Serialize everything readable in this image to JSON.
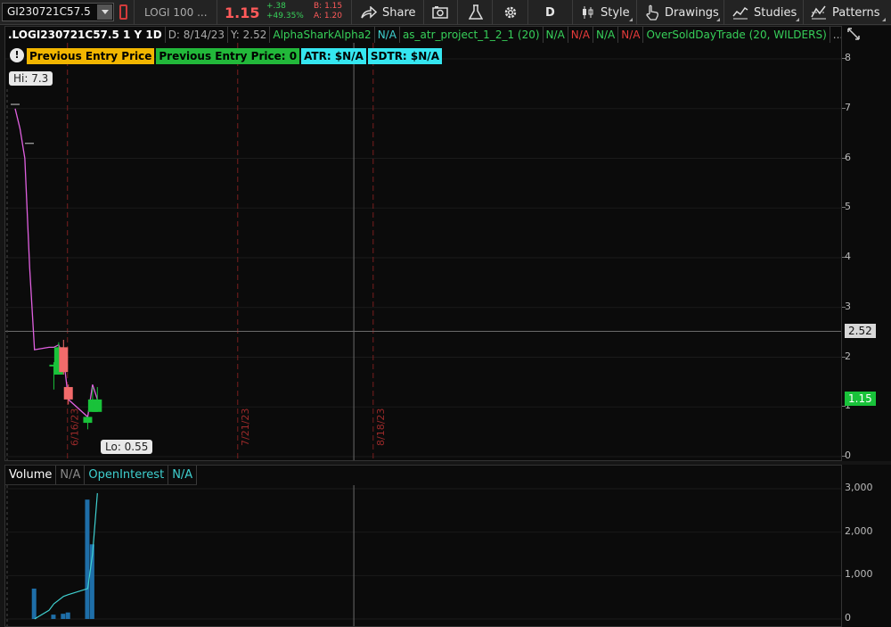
{
  "toolbar": {
    "symbol": "GI230721C57.5",
    "description": "LOGI 100 ...",
    "last": "1.15",
    "net_change": "+.38",
    "pct_change": "+49.35%",
    "bid": "B: 1.15",
    "ask": "A: 1.20",
    "share": "Share",
    "period": "D",
    "style": "Style",
    "drawings": "Drawings",
    "studies": "Studies",
    "patterns": "Patterns"
  },
  "info": {
    "title": ".LOGI230721C57.5 1 Y 1D",
    "date": "D: 8/14/23",
    "y": "Y: 2.52",
    "study1": "AlphaSharkAlpha2",
    "study1_val": "N/A",
    "study2": "as_atr_project_1_2_1 (20)",
    "study2_v1": "N/A",
    "study2_v2": "N/A",
    "study2_v3": "N/A",
    "study2_v4": "N/A",
    "study3": "OverSoldDayTrade (20, WILDERS)",
    "more": "..."
  },
  "badges": {
    "alert": "!",
    "prev_entry": "Previous Entry Price",
    "prev_entry_val": "Previous Entry Price: 0",
    "atr": "ATR: $N/A",
    "sdtr": "SDTR: $N/A"
  },
  "callouts": {
    "hi": "Hi: 7.3",
    "lo": "Lo: 0.55"
  },
  "dates": [
    "6/16/23",
    "7/21/23",
    "8/18/23"
  ],
  "price_axis": {
    "ticks": [
      "8",
      "7",
      "6",
      "5",
      "4",
      "3",
      "2",
      "1",
      "0"
    ],
    "cursor_value": "2.52",
    "last_value": "1.15"
  },
  "volume": {
    "label": "Volume",
    "value": "N/A",
    "oi_label": "OpenInterest",
    "oi_value": "N/A",
    "ticks": [
      "3,000",
      "2,000",
      "1,000",
      "0"
    ]
  },
  "colors": {
    "up": "#19c23a",
    "down": "#f26b6b",
    "line": "#e060e0",
    "oi": "#3fd0d0",
    "vol": "#1e6ea8",
    "accent_green": "#37d05a"
  },
  "chart_data": {
    "type": "candlestick",
    "x": [
      "6/13/23",
      "6/14/23",
      "6/15/23",
      "6/16/23",
      "6/20/23",
      "6/21/23",
      "6/22/23"
    ],
    "open": [
      1.85,
      1.65,
      2.2,
      1.4,
      0.68,
      0.9,
      0.9
    ],
    "high": [
      1.9,
      2.3,
      2.35,
      1.45,
      0.8,
      1.4,
      1.4
    ],
    "low": [
      1.35,
      1.65,
      1.65,
      1.05,
      0.55,
      0.9,
      0.9
    ],
    "close": [
      1.85,
      2.2,
      1.7,
      1.15,
      0.8,
      1.15,
      1.15
    ],
    "line_x": [
      "6/5/23",
      "6/6/23",
      "6/7/23",
      "6/8/23",
      "6/9/23",
      "6/12/23",
      "6/13/23",
      "6/14/23",
      "6/15/23",
      "6/16/23",
      "6/20/23",
      "6/21/23",
      "6/22/23"
    ],
    "line_y": [
      7.0,
      6.6,
      6.0,
      3.8,
      2.15,
      2.2,
      2.2,
      2.25,
      2.0,
      1.15,
      0.8,
      1.45,
      1.15
    ],
    "volume_x": [
      "6/9/23",
      "6/13/23",
      "6/15/23",
      "6/16/23",
      "6/20/23",
      "6/21/23"
    ],
    "volume": [
      700,
      100,
      120,
      150,
      2750,
      1720
    ],
    "oi_x": [
      "6/9/23",
      "6/12/23",
      "6/13/23",
      "6/15/23",
      "6/16/23",
      "6/20/23",
      "6/21/23",
      "6/22/23"
    ],
    "open_interest": [
      0,
      200,
      350,
      520,
      560,
      700,
      1500,
      2900
    ],
    "ylim": [
      0,
      8.2
    ],
    "vol_ylim": [
      0,
      3000
    ]
  }
}
